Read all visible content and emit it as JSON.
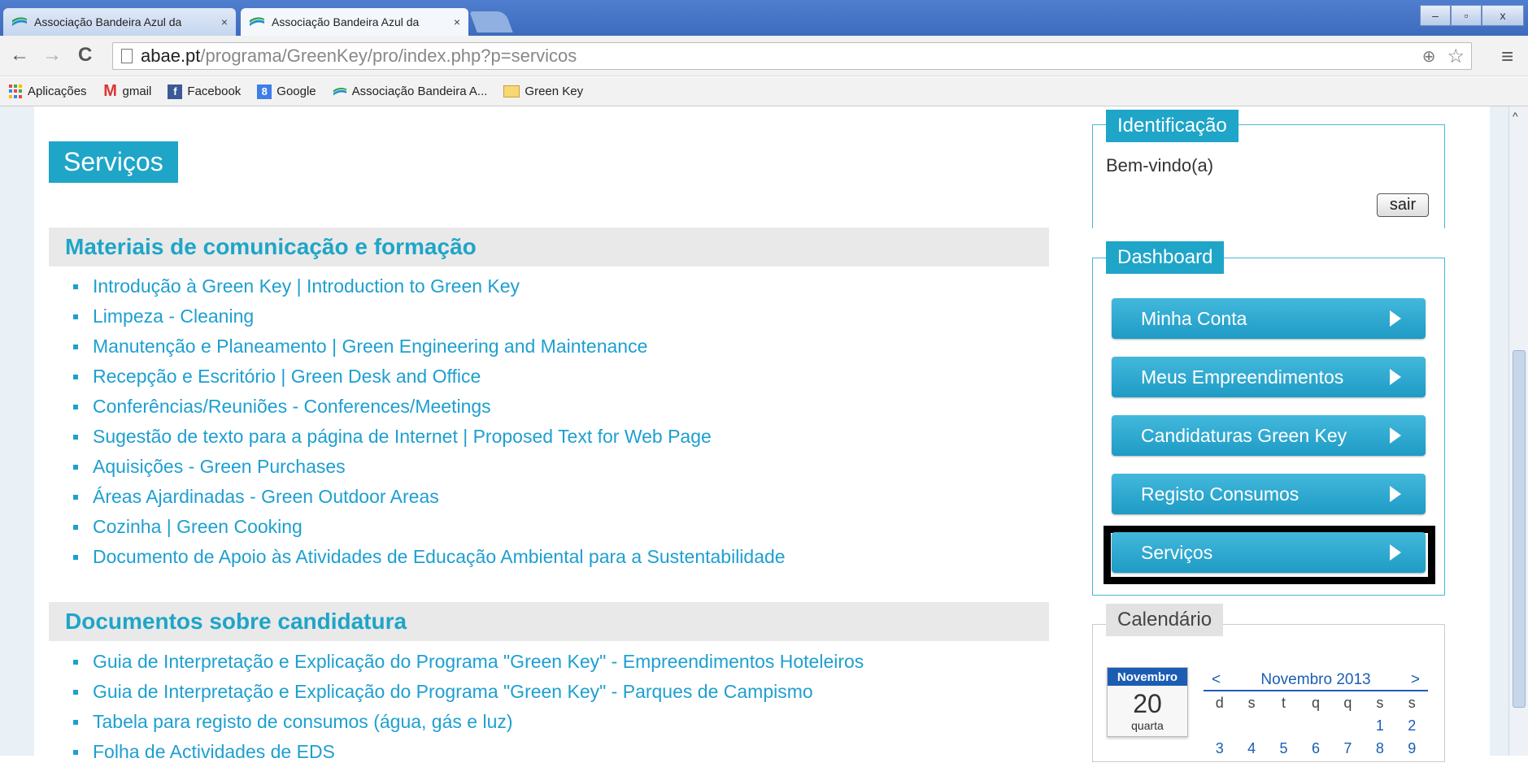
{
  "browser": {
    "tabs": [
      {
        "label": "Associação Bandeira Azul da",
        "close": "×"
      },
      {
        "label": "Associação Bandeira Azul da",
        "close": "×"
      }
    ],
    "window_controls": {
      "minimize": "–",
      "maximize": "▫",
      "close": "x"
    },
    "url": {
      "host": "abae.pt",
      "path": "/programa/GreenKey/pro/index.php?p=servicos"
    },
    "bookmarks": [
      {
        "label": "Aplicações",
        "icon": "apps-grid-icon"
      },
      {
        "label": "gmail",
        "icon": "gmail-icon"
      },
      {
        "label": "Facebook",
        "icon": "facebook-icon"
      },
      {
        "label": "Google",
        "icon": "google-icon"
      },
      {
        "label": "Associação Bandeira A...",
        "icon": "abae-icon"
      },
      {
        "label": "Green Key",
        "icon": "folder-icon"
      }
    ]
  },
  "main": {
    "title": "Serviços",
    "sections": [
      {
        "heading": "Materiais de comunicação e formação",
        "items": [
          "Introdução à Green Key | Introduction to Green Key",
          "Limpeza - Cleaning",
          "Manutenção e Planeamento | Green Engineering and Maintenance",
          "Recepção e Escritório | Green Desk and Office",
          "Conferências/Reuniões - Conferences/Meetings",
          "Sugestão de texto para a página de Internet | Proposed Text for Web Page",
          "Aquisições - Green Purchases",
          "Áreas Ajardinadas - Green Outdoor Areas",
          "Cozinha | Green Cooking",
          "Documento de Apoio às Atividades de Educação Ambiental para a Sustentabilidade"
        ]
      },
      {
        "heading": "Documentos sobre candidatura",
        "items": [
          "Guia de Interpretação e Explicação do Programa \"Green Key\" - Empreendimentos Hoteleiros",
          "Guia de Interpretação e Explicação do Programa \"Green Key\" - Parques de Campismo",
          "Tabela para registo de consumos (água, gás e luz)",
          "Folha de Actividades de EDS"
        ]
      }
    ]
  },
  "sidebar": {
    "identification": {
      "title": "Identificação",
      "welcome": "Bem-vindo(a)",
      "logout": "sair"
    },
    "dashboard": {
      "title": "Dashboard",
      "buttons": [
        "Minha Conta",
        "Meus Empreendimentos",
        "Candidaturas Green Key",
        "Registo Consumos",
        "Serviços"
      ]
    },
    "calendar": {
      "title": "Calendário",
      "card_month": "Novembro",
      "card_day": "20",
      "card_weekday": "quarta",
      "prev": "<",
      "next": ">",
      "month_label": "Novembro 2013",
      "weekdays": [
        "d",
        "s",
        "t",
        "q",
        "q",
        "s",
        "s"
      ],
      "row1": [
        "",
        "",
        "",
        "",
        "",
        "1",
        "2"
      ],
      "row2": [
        "3",
        "4",
        "5",
        "6",
        "7",
        "8",
        "9"
      ]
    }
  }
}
